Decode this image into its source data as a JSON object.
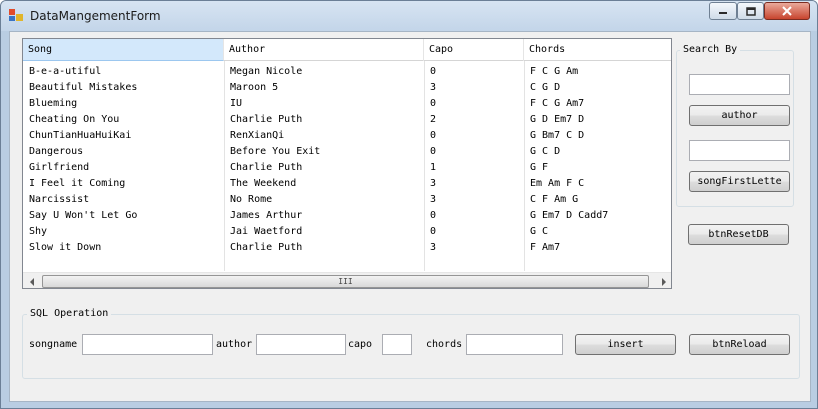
{
  "window": {
    "title": "DataMangementForm"
  },
  "grid": {
    "columns": [
      "Song",
      "Author",
      "Capo",
      "Chords"
    ],
    "rows": [
      [
        "B-e-a-utiful",
        "Megan Nicole",
        "0",
        "F C G Am"
      ],
      [
        "Beautiful Mistakes",
        "Maroon 5",
        "3",
        "C G D"
      ],
      [
        "Blueming",
        "IU",
        "0",
        "F C G Am7"
      ],
      [
        "Cheating On You",
        "Charlie Puth",
        "2",
        "G D Em7 D"
      ],
      [
        "ChunTianHuaHuiKai",
        "RenXianQi",
        "0",
        "G Bm7 C D"
      ],
      [
        "Dangerous",
        "Before You Exit",
        "0",
        "G C D"
      ],
      [
        "Girlfriend",
        "Charlie Puth",
        "1",
        "G F"
      ],
      [
        "I Feel it Coming",
        "The Weekend",
        "3",
        "Em Am F C"
      ],
      [
        "Narcissist",
        "No Rome",
        "3",
        "C F Am G"
      ],
      [
        "Say U Won't Let Go",
        "James Arthur",
        "0",
        "G Em7 D Cadd7"
      ],
      [
        "Shy",
        "Jai Waetford",
        "0",
        "G C"
      ],
      [
        "Slow it Down",
        "Charlie Puth",
        "3",
        "F Am7"
      ]
    ],
    "scroll_thumb_glyph": "III"
  },
  "search": {
    "legend": "Search By",
    "author_value": "",
    "first_letter_value": "",
    "author_button": "author",
    "first_letter_button": "songFirstLette"
  },
  "reset_button": "btnResetDB",
  "sql": {
    "legend": "SQL Operation",
    "songname_label": "songname",
    "songname_value": "",
    "author_label": "author",
    "author_value": "",
    "capo_label": "capo",
    "capo_value": "",
    "chords_label": "chords",
    "chords_value": "",
    "insert_button": "insert",
    "reload_button": "btnReload"
  },
  "icons": {
    "app": "app-form-icon",
    "minimize": "minimize-icon",
    "maximize": "maximize-icon",
    "close": "close-icon"
  }
}
